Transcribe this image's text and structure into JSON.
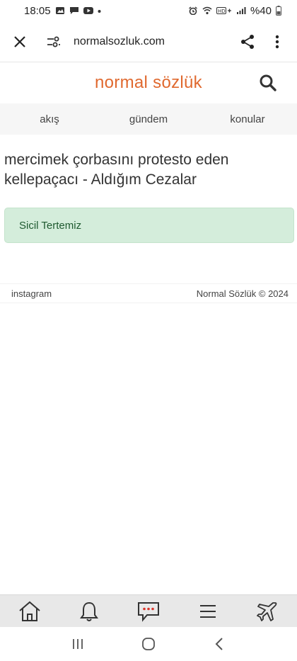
{
  "status_bar": {
    "time": "18:05",
    "battery": "%40"
  },
  "browser": {
    "url": "normalsozluk.com"
  },
  "site": {
    "logo": "normal sözlük",
    "nav": [
      "akış",
      "gündem",
      "konular"
    ]
  },
  "content": {
    "title": "mercimek çorbasını protesto eden kellepaçacı - Aldığım Cezalar",
    "alert": "Sicil Tertemiz"
  },
  "footer": {
    "left": "instagram",
    "right": "Normal Sözlük © 2024"
  },
  "colors": {
    "brand": "#e0692f",
    "alert_bg": "#d4eddb",
    "alert_text": "#1f5a30"
  },
  "icons": {
    "bottom_bar": [
      "home-icon",
      "bell-icon",
      "chat-icon",
      "menu-icon",
      "airplane-icon"
    ],
    "system_nav": [
      "recents-icon",
      "home-circle-icon",
      "back-icon"
    ]
  }
}
